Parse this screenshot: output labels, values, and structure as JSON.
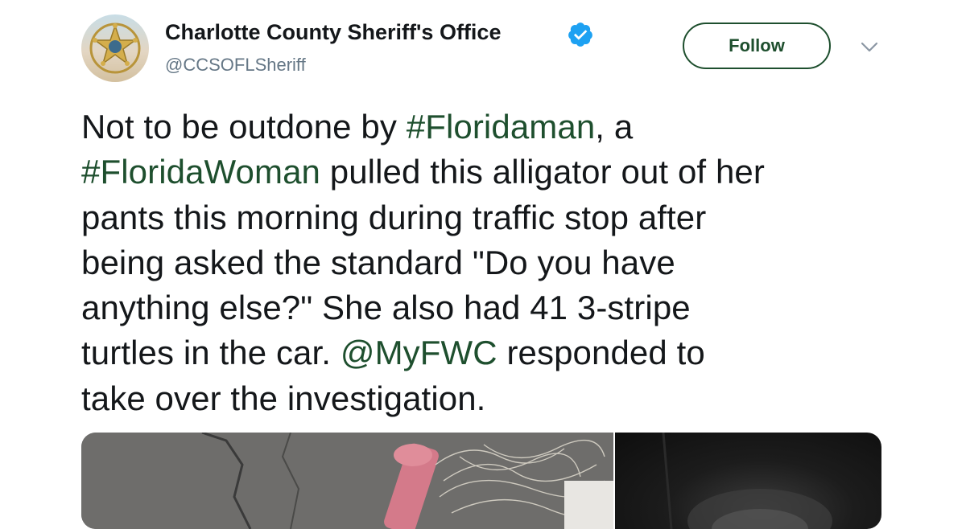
{
  "header": {
    "display_name": "Charlotte County Sheriff's Office",
    "handle": "@CCSOFLSheriff",
    "verified": true,
    "follow_label": "Follow"
  },
  "tweet": {
    "lines": [
      [
        {
          "t": "Not to be outdone by ",
          "k": "text"
        },
        {
          "t": "#Floridaman",
          "k": "hashtag"
        },
        {
          "t": ", a",
          "k": "text"
        }
      ],
      [
        {
          "t": "#FloridaWoman",
          "k": "hashtag"
        },
        {
          "t": " pulled this alligator out of her",
          "k": "text"
        }
      ],
      [
        {
          "t": "pants this morning during traffic stop after",
          "k": "text"
        }
      ],
      [
        {
          "t": "being asked the standard \"Do you have",
          "k": "text"
        }
      ],
      [
        {
          "t": "anything else?\" She also had 41 3-stripe",
          "k": "text"
        }
      ],
      [
        {
          "t": "turtles in the car. ",
          "k": "text"
        },
        {
          "t": "@MyFWC",
          "k": "mention"
        },
        {
          "t": " responded to",
          "k": "text"
        }
      ],
      [
        {
          "t": "take over the investigation.",
          "k": "text"
        }
      ]
    ]
  },
  "colors": {
    "link": "#1e4f2e",
    "verified": "#1da1f2",
    "text": "#14171a",
    "secondary": "#657786"
  },
  "icons": {
    "avatar": "sheriff-star-badge",
    "verified": "verified-badge-icon",
    "menu": "chevron-down-icon"
  }
}
